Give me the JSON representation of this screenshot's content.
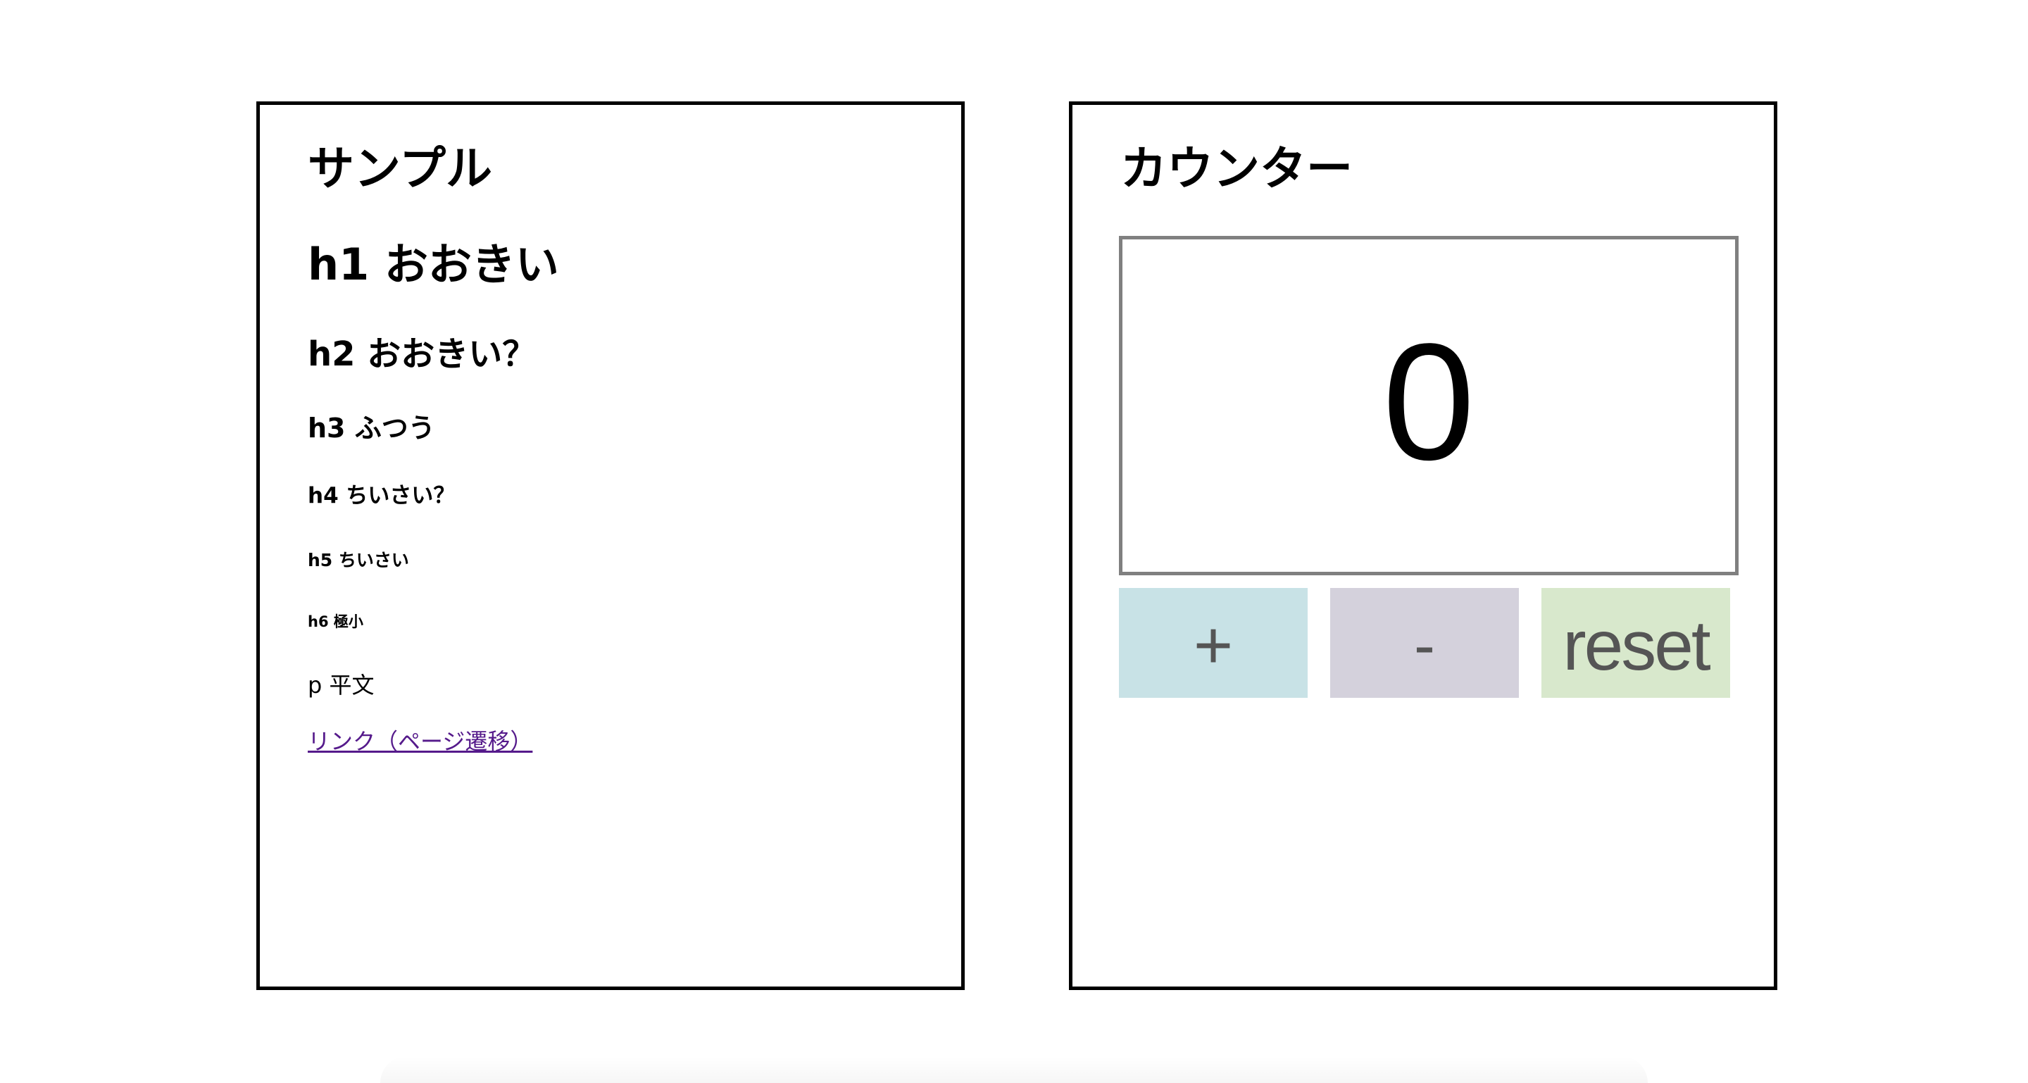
{
  "sample_card": {
    "title": "サンプル",
    "h1": "h1 おおきい",
    "h2": "h2 おおきい？",
    "h3": "h3 ふつう",
    "h4": "h4 ちいさい？",
    "h5": "h5 ちいさい",
    "h6": "h6 極小",
    "paragraph": "p 平文",
    "link": "リンク（ページ遷移）"
  },
  "counter_card": {
    "title": "カウンター",
    "value": "0",
    "buttons": {
      "increment_label": "+",
      "decrement_label": "-",
      "reset_label": "reset"
    }
  },
  "colors": {
    "increment_bg": "#c8e2e6",
    "decrement_bg": "#d4d1dc",
    "reset_bg": "#d8e8cc",
    "display_border": "#808080",
    "link": "#551a8b"
  }
}
